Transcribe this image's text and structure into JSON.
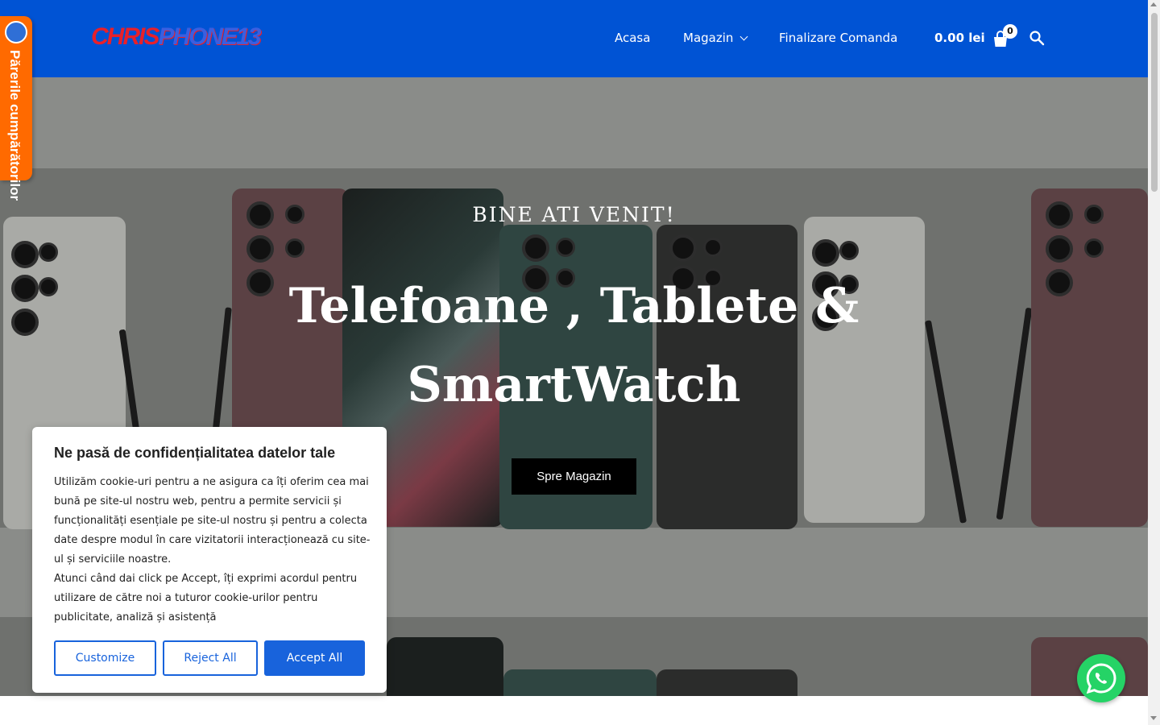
{
  "header": {
    "logo_part1": "CHRIS",
    "logo_part2": "PHONE13",
    "nav": {
      "home": "Acasa",
      "shop": "Magazin",
      "checkout": "Finalizare Comanda"
    },
    "cart_total": "0.00 lei",
    "cart_count": "0",
    "icons": {
      "cart": "shopping-bag-icon",
      "search": "search-icon",
      "dropdown": "chevron-down-icon"
    },
    "background_color": "#0053d4"
  },
  "reviews_tab": {
    "label": "Părerile cumpărătorilor",
    "color": "#ff6a00"
  },
  "hero": {
    "subtitle": "BINE ATI VENIT!",
    "title": "Telefoane , Tablete & SmartWatch",
    "button_label": "Spre Magazin"
  },
  "cookie_banner": {
    "title": "Ne pasă de confidențialitatea datelor tale",
    "paragraph1": "Utilizăm cookie-uri pentru a ne asigura ca îți oferim cea mai bună pe site-ul nostru web, pentru a permite servicii și funcționalități esențiale pe site-ul nostru și pentru a colecta date despre modul în care vizitatorii interacționează cu site-ul și serviciile noastre.",
    "paragraph2": "Atunci când dai click pe Accept, îți exprimi acordul pentru utilizare de către noi a tuturor cookie-urilor pentru publicitate, analiză și asistență",
    "buttons": {
      "customize": "Customize",
      "reject": "Reject All",
      "accept": "Accept All"
    },
    "accent_color": "#1863dc"
  },
  "whatsapp": {
    "icon": "whatsapp-icon",
    "color": "#25d366"
  }
}
